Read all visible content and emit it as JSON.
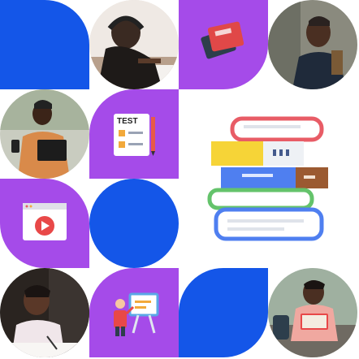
{
  "tiles": {
    "test_icon_label": "TEST"
  },
  "colors": {
    "blue": "#1456e8",
    "purple": "#a54be9"
  },
  "icons": [
    "books-icon",
    "test-checklist-icon",
    "video-play-icon",
    "teacher-board-icon",
    "book-stack-icon"
  ],
  "photos": [
    "student-headphones-writing",
    "man-with-backpack",
    "woman-with-phone-and-notebook",
    "girl-writing-at-desk",
    "man-reading-book-outdoors"
  ]
}
